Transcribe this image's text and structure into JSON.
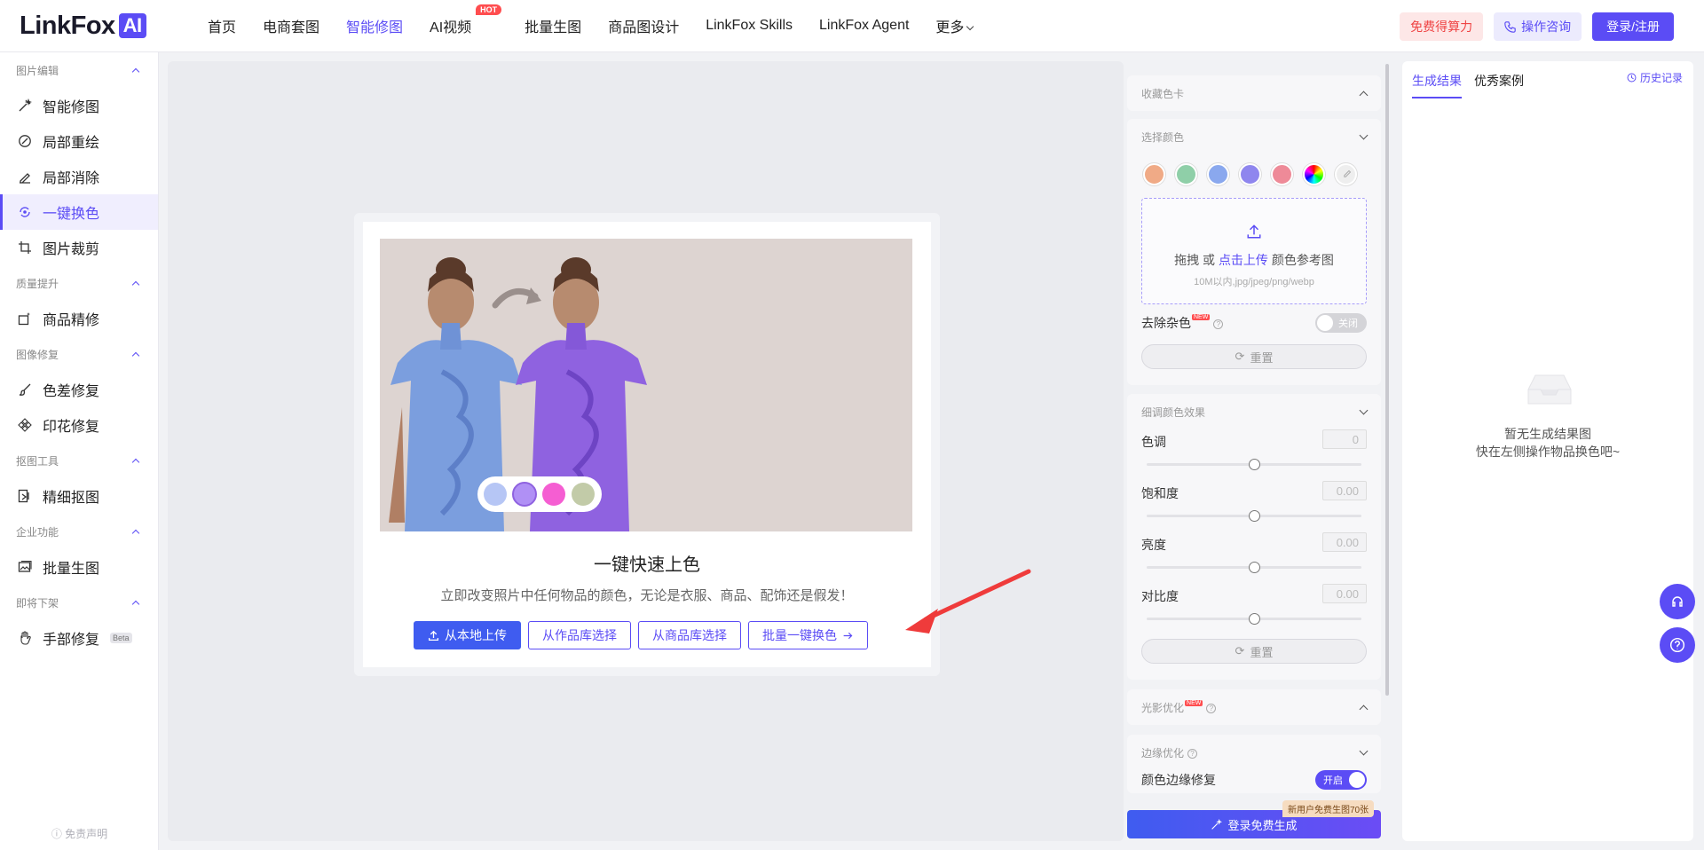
{
  "brand": {
    "logo_text": "LinkFox",
    "logo_badge": "AI",
    "accent": "#5b4cf5"
  },
  "nav": {
    "items": [
      "首页",
      "电商套图",
      "智能修图",
      "AI视频",
      "批量生图",
      "商品图设计",
      "LinkFox Skills",
      "LinkFox Agent",
      "更多"
    ],
    "hot_badge": "HOT"
  },
  "top_actions": {
    "free": "免费得算力",
    "consult": "操作咨询",
    "login": "登录/注册"
  },
  "sidebar": {
    "sections": [
      {
        "title": "图片编辑",
        "items": [
          "智能修图",
          "局部重绘",
          "局部消除",
          "一键换色",
          "图片裁剪"
        ]
      },
      {
        "title": "质量提升",
        "items": [
          "商品精修"
        ]
      },
      {
        "title": "图像修复",
        "items": [
          "色差修复",
          "印花修复"
        ]
      },
      {
        "title": "抠图工具",
        "items": [
          "精细抠图"
        ]
      },
      {
        "title": "企业功能",
        "items": [
          "批量生图"
        ]
      },
      {
        "title": "即将下架",
        "items": [
          "手部修复"
        ]
      }
    ],
    "beta_badge": "Beta",
    "disclaimer": "免责声明"
  },
  "card": {
    "title": "一键快速上色",
    "subtitle": "立即改变照片中任何物品的颜色，无论是衣服、商品、配饰还是假发！",
    "buttons": {
      "upload": "从本地上传",
      "gallery": "从作品库选择",
      "product": "从商品库选择",
      "batch": "批量一键换色"
    }
  },
  "panel": {
    "saved_colors": "收藏色卡",
    "select_color": "选择颜色",
    "swatch_colors": [
      "#f0aa86",
      "#8fcfa8",
      "#8aa8ee",
      "#8f86ee",
      "#ee8a98"
    ],
    "upload": {
      "drag": "拖拽 或",
      "click": "点击上传",
      "ref": "颜色参考图",
      "hint": "10M以内,jpg/jpeg/png/webp"
    },
    "remove_noise": "去除杂色",
    "remove_noise_state": "关闭",
    "new_badge": "NEW",
    "reset": "重置",
    "fine_tune": "细调颜色效果",
    "sliders": [
      {
        "label": "色调",
        "value": "0",
        "position": 0.5
      },
      {
        "label": "饱和度",
        "value": "0.00",
        "position": 0.5
      },
      {
        "label": "亮度",
        "value": "0.00",
        "position": 0.5
      },
      {
        "label": "对比度",
        "value": "0.00",
        "position": 0.5
      }
    ],
    "lighting": "光影优化",
    "edge": "边缘优化",
    "edge_fix": "颜色边缘修复",
    "edge_fix_state": "开启",
    "promo": "新用户免费生图70张",
    "generate": "登录免费生成"
  },
  "results": {
    "tabs": [
      "生成结果",
      "优秀案例"
    ],
    "history": "历史记录",
    "empty_line1": "暂无生成结果图",
    "empty_line2": "快在左侧操作物品换色吧~"
  }
}
